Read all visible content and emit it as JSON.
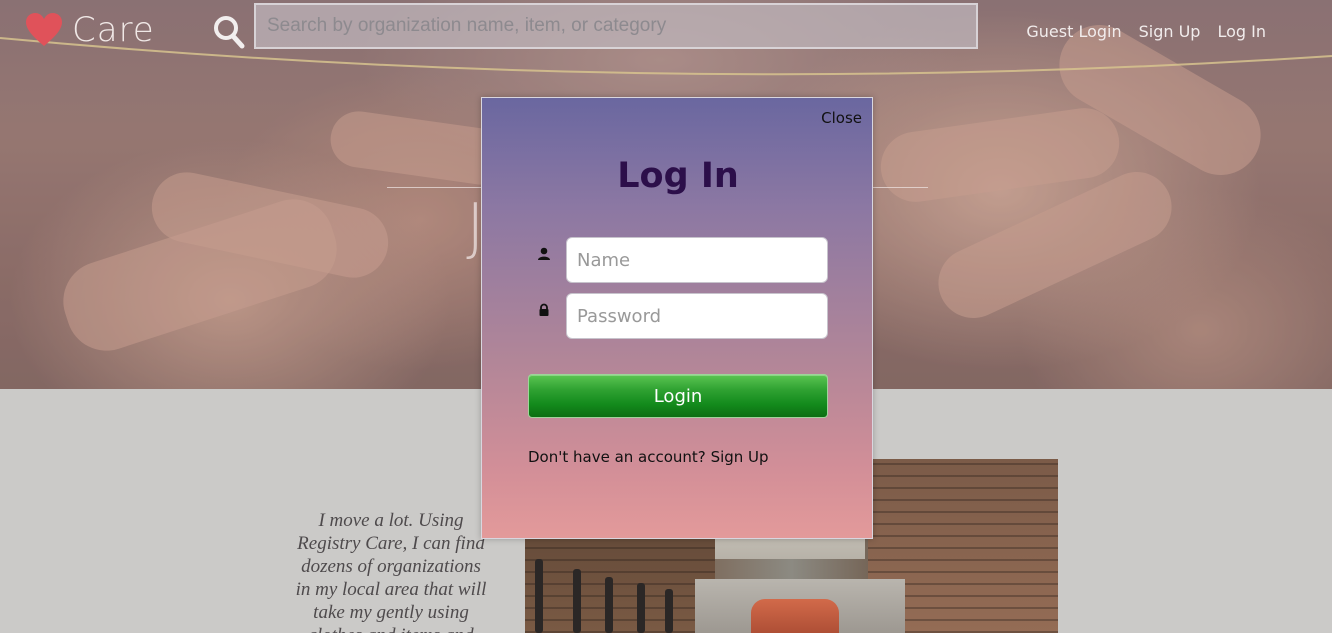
{
  "header": {
    "logo_text": "Care",
    "search_placeholder": "Search by organization name, item, or category",
    "nav": {
      "guest_login": "Guest Login",
      "sign_up": "Sign Up",
      "log_in": "Log In"
    }
  },
  "hero": {
    "tagline": "JUST CARE FOR"
  },
  "testimonial": {
    "quote_lines": [
      "I move a lot. Using",
      "Registry Care, I can find",
      "dozens of organizations",
      "in my local area that will",
      "take my gently using",
      "clothes and items and"
    ]
  },
  "modal": {
    "close_label": "Close",
    "title": "Log In",
    "name_placeholder": "Name",
    "password_placeholder": "Password",
    "login_label": "Login",
    "signup_prompt": "Don't have an account?",
    "signup_link": "Sign Up"
  },
  "icons": {
    "logo": "heart-icon",
    "search": "search-icon",
    "name_field": "user-icon",
    "password_field": "lock-icon"
  },
  "colors": {
    "heart": "#e0525a",
    "modal_title": "#2c0f4a",
    "login_button": "#1e9326"
  }
}
